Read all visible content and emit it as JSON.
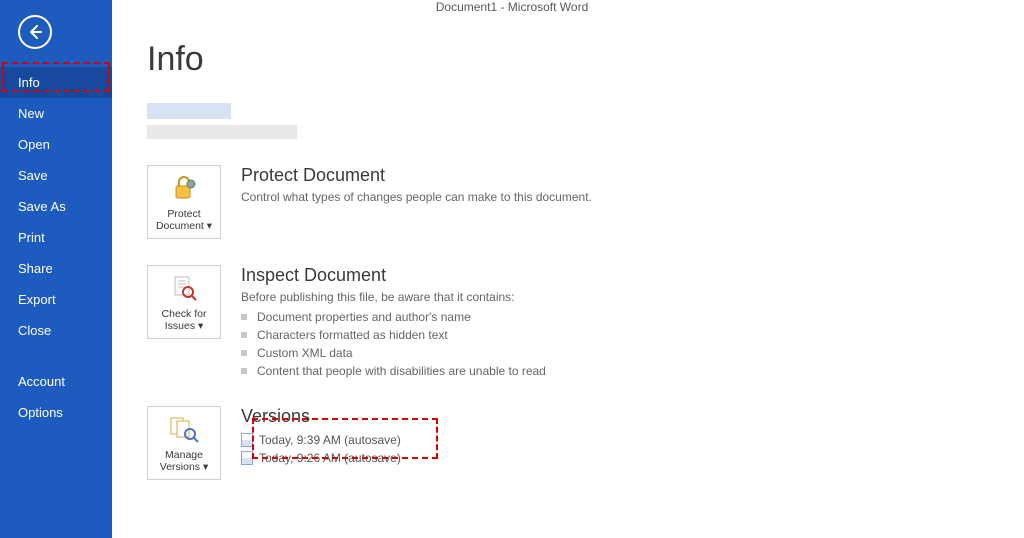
{
  "window": {
    "title": "Document1 - Microsoft Word"
  },
  "sidebar": {
    "items": [
      {
        "label": "Info",
        "selected": true
      },
      {
        "label": "New",
        "selected": false
      },
      {
        "label": "Open",
        "selected": false
      },
      {
        "label": "Save",
        "selected": false
      },
      {
        "label": "Save As",
        "selected": false
      },
      {
        "label": "Print",
        "selected": false
      },
      {
        "label": "Share",
        "selected": false
      },
      {
        "label": "Export",
        "selected": false
      },
      {
        "label": "Close",
        "selected": false
      },
      {
        "label": "Account",
        "selected": false
      },
      {
        "label": "Options",
        "selected": false
      }
    ]
  },
  "page": {
    "title": "Info"
  },
  "protect": {
    "tile_label": "Protect Document ▾",
    "heading": "Protect Document",
    "description": "Control what types of changes people can make to this document."
  },
  "inspect": {
    "tile_label": "Check for Issues ▾",
    "heading": "Inspect Document",
    "intro": "Before publishing this file, be aware that it contains:",
    "items": [
      "Document properties and author's name",
      "Characters formatted as hidden text",
      "Custom XML data",
      "Content that people with disabilities are unable to read"
    ]
  },
  "versions": {
    "tile_label": "Manage Versions ▾",
    "heading": "Versions",
    "list": [
      {
        "label": "Today, 9:39 AM (autosave)"
      },
      {
        "label": "Today, 9:26 AM (autosave)"
      }
    ]
  }
}
